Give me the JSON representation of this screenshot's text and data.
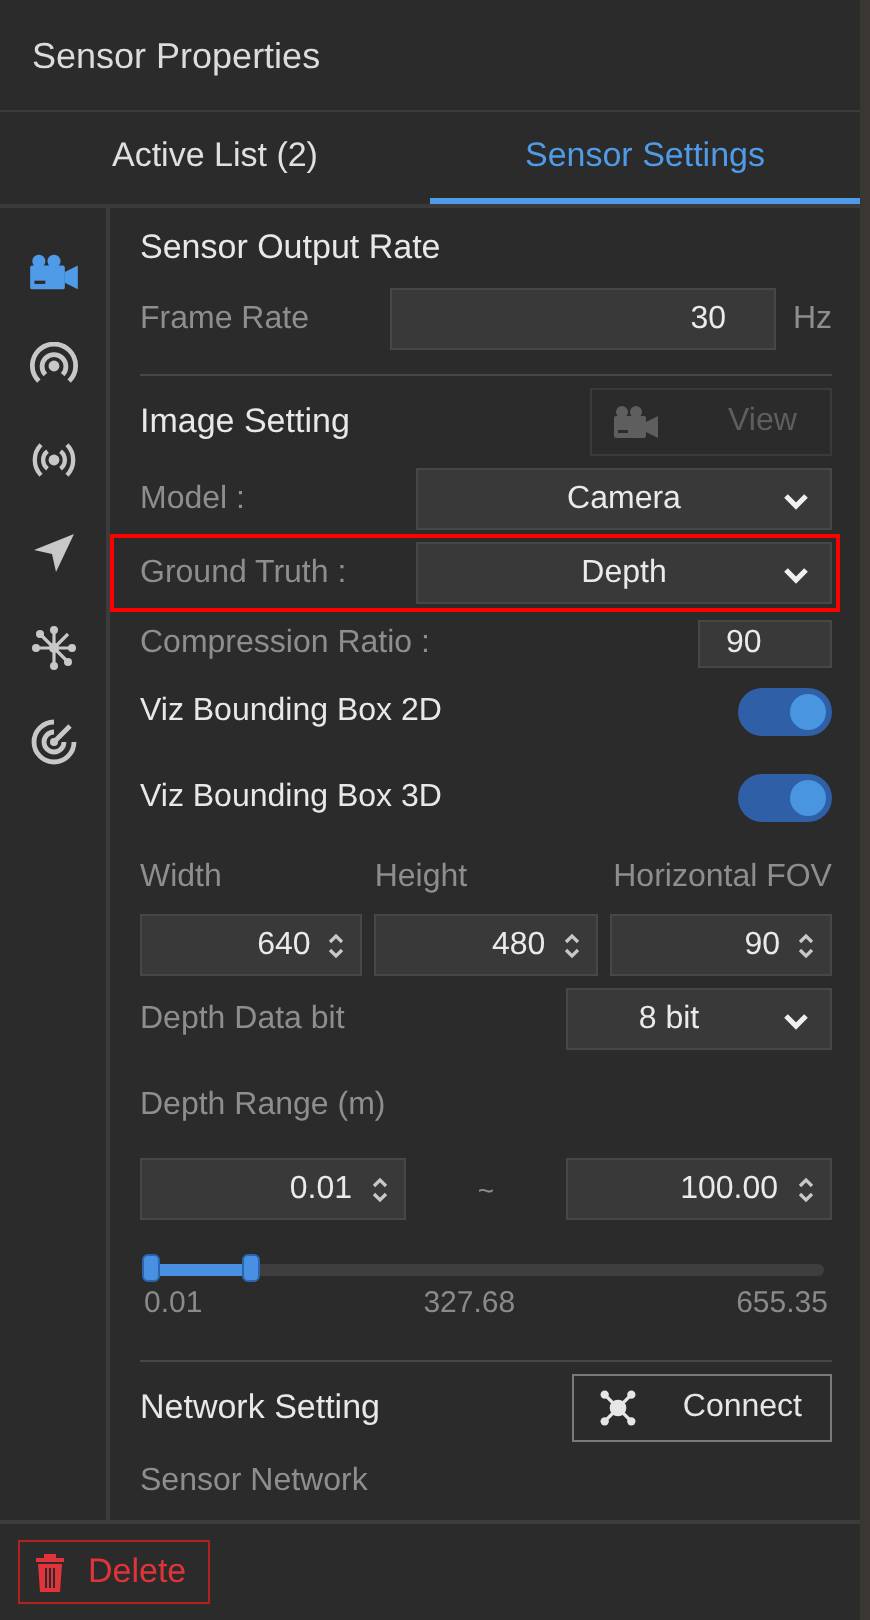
{
  "panel": {
    "title": "Sensor Properties"
  },
  "tabs": [
    {
      "label": "Active List  (2)",
      "selected": false
    },
    {
      "label": "Sensor Settings",
      "selected": true
    }
  ],
  "sidebar": {
    "items": [
      {
        "kind": "camera",
        "selected": true
      },
      {
        "kind": "radar",
        "selected": false
      },
      {
        "kind": "broadcast",
        "selected": false
      },
      {
        "kind": "navigation",
        "selected": false
      },
      {
        "kind": "network",
        "selected": false
      },
      {
        "kind": "target",
        "selected": false
      }
    ]
  },
  "sections": [
    {
      "title": "Sensor Output Rate",
      "rows": [
        {
          "kind": "number",
          "label": "Frame Rate",
          "value": "30",
          "unit": "Hz"
        }
      ]
    },
    {
      "title": "Image Setting",
      "button": {
        "label": "View",
        "kind": "camera",
        "disabled": true
      },
      "rows": [
        {
          "kind": "select",
          "label": "Model :",
          "value": "Camera",
          "highlighted": false
        },
        {
          "kind": "select",
          "label": "Ground Truth :",
          "value": "Depth",
          "highlighted": true
        },
        {
          "kind": "input",
          "label": "Compression Ratio :",
          "value": "90"
        },
        {
          "kind": "toggle",
          "label": "Viz Bounding Box 2D",
          "on": true
        },
        {
          "kind": "toggle",
          "label": "Viz Bounding Box 3D",
          "on": true
        },
        {
          "kind": "spinners",
          "fields": [
            {
              "label": "Width",
              "value": "640"
            },
            {
              "label": "Height",
              "value": "480"
            },
            {
              "label": "Horizontal FOV",
              "value": "90"
            }
          ]
        },
        {
          "kind": "smallselect",
          "label": "Depth Data bit",
          "value": "8 bit"
        },
        {
          "kind": "heading",
          "label": "Depth Range (m)"
        },
        {
          "kind": "range",
          "min": "0.01",
          "separator": "~",
          "max": "100.00"
        },
        {
          "kind": "slider",
          "level": 0.15,
          "ticks": [
            "0.01",
            "327.68",
            "655.35"
          ]
        }
      ]
    },
    {
      "title": "Network Setting",
      "button": {
        "label": "Connect",
        "kind": "network",
        "disabled": false
      },
      "rows": [
        {
          "kind": "heading",
          "label": "Sensor Network"
        }
      ]
    }
  ],
  "footer": {
    "button": "Delete"
  }
}
